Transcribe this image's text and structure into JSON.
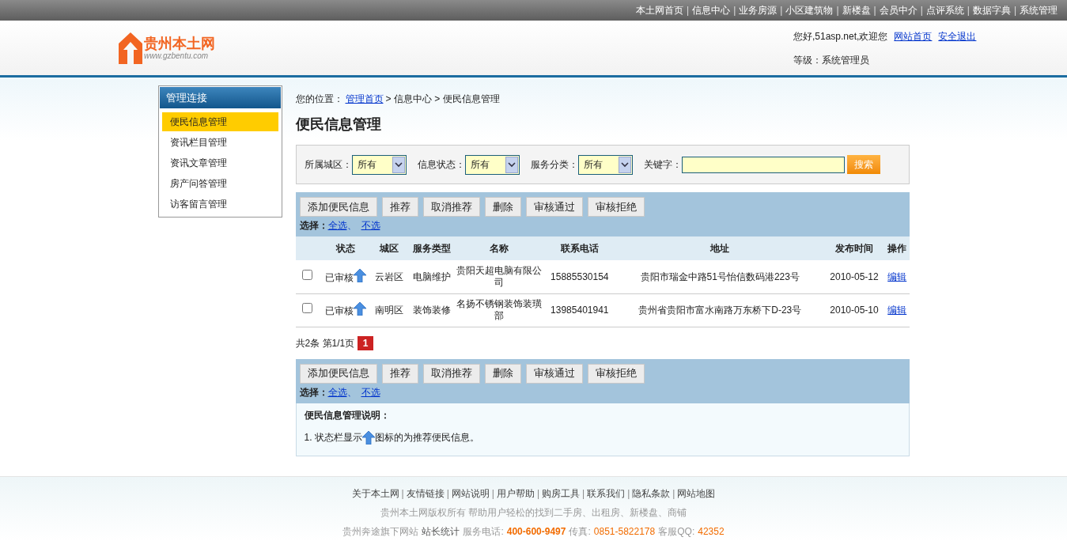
{
  "top_nav": [
    "本土网首页",
    "信息中心",
    "业务房源",
    "小区建筑物",
    "新楼盘",
    "会员中介",
    "点评系统",
    "数据字典",
    "系统管理"
  ],
  "top_nav_separator": "|",
  "logo": {
    "name": "贵州本土网",
    "url": "www.gzbentu.com"
  },
  "user": {
    "greeting": "您好,51asp.net,欢迎您",
    "links": [
      "网站首页",
      "安全退出"
    ],
    "level": "等级：系统管理员"
  },
  "sidebar": {
    "title": "管理连接",
    "items": [
      {
        "label": "便民信息管理",
        "selected": true
      },
      {
        "label": "资讯栏目管理",
        "selected": false
      },
      {
        "label": "资讯文章管理",
        "selected": false
      },
      {
        "label": "房产问答管理",
        "selected": false
      },
      {
        "label": "访客留言管理",
        "selected": false
      }
    ]
  },
  "breadcrumb": {
    "prefix": "您的位置：",
    "link": "管理首页",
    "rest": "> 信息中心 > 便民信息管理"
  },
  "page_title": "便民信息管理",
  "filters": [
    {
      "label": "所属城区：",
      "value": "所有"
    },
    {
      "label": "信息状态：",
      "value": "所有"
    },
    {
      "label": "服务分类：",
      "value": "所有"
    }
  ],
  "keyword": {
    "label": "关键字："
  },
  "search_button": "搜索",
  "toolbar_top": {
    "buttons": [
      "添加便民信息",
      "推荐",
      "取消推荐",
      "删除",
      "审核通过",
      "审核拒绝"
    ],
    "select_label": "选择：",
    "select_links": [
      "全选",
      "不选"
    ],
    "separator": "、"
  },
  "table": {
    "columns": [
      "状态",
      "城区",
      "服务类型",
      "名称",
      "联系电话",
      "地址",
      "发布时间",
      "操作"
    ],
    "rows": [
      {
        "checked": false,
        "status": "已审核",
        "recommended": true,
        "district": "云岩区",
        "type": "电脑维护",
        "name": "贵阳天超电脑有限公司",
        "phone": "15885530154",
        "address": "贵阳市瑞金中路51号怡信数码港223号",
        "date": "2010-05-12",
        "action": "编辑"
      },
      {
        "checked": false,
        "status": "已审核",
        "recommended": true,
        "district": "南明区",
        "type": "装饰装修",
        "name": "名扬不锈钢装饰装璜部",
        "phone": "13985401941",
        "address": "贵州省贵阳市富水南路万东桥下D-23号",
        "date": "2010-05-10",
        "action": "编辑"
      }
    ]
  },
  "pagination": {
    "summary": "共2条 第1/1页",
    "pages": [
      {
        "label": "1",
        "selected": true
      }
    ]
  },
  "toolbar_bottom": {
    "buttons": [
      "添加便民信息",
      "推荐",
      "取消推荐",
      "删除",
      "审核通过",
      "审核拒绝"
    ],
    "select_label": "选择：",
    "select_links": [
      "全选",
      "不选"
    ],
    "separator": "、"
  },
  "notes": {
    "title": "便民信息管理说明：",
    "before_icon": "1. 状态栏显示",
    "after_icon": "图标的为推荐便民信息。"
  },
  "footer": {
    "separator": "|",
    "links": [
      "关于本土网",
      "友情链接",
      "网站说明",
      "用户帮助",
      "购房工具",
      "联系我们",
      "隐私条款",
      "网站地图"
    ],
    "copyright": "贵州本土网版权所有 帮助用户轻松的找到二手房、出租房、新楼盘、商铺",
    "info": [
      {
        "kind": "plain",
        "text": "贵州奔途旗下网站"
      },
      {
        "kind": "link",
        "text": "站长统计"
      },
      {
        "kind": "plain",
        "text": "服务电话:"
      },
      {
        "kind": "strong",
        "text": "400-600-9497"
      },
      {
        "kind": "plain",
        "text": "传真:"
      },
      {
        "kind": "accent",
        "text": "0851-5822178"
      },
      {
        "kind": "plain",
        "text": "客服QQ:"
      },
      {
        "kind": "accent",
        "text": "42352"
      }
    ]
  }
}
